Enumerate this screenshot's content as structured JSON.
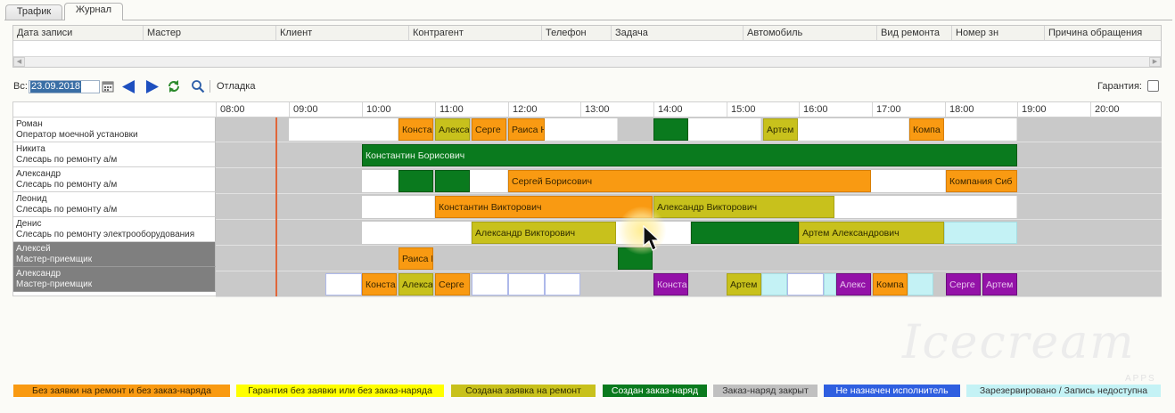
{
  "tabs": [
    {
      "label": "Трафик",
      "active": false
    },
    {
      "label": "Журнал",
      "active": true
    }
  ],
  "journal_columns": [
    "Дата записи",
    "Мастер",
    "Клиент",
    "Контрагент",
    "Телефон",
    "Задача",
    "Автомобиль",
    "Вид ремонта",
    "Номер зн",
    "Причина обращения"
  ],
  "toolbar": {
    "date_label": "Вс:",
    "date_value": "23.09.2018",
    "debug_label": "Отладка",
    "warranty_label": "Гарантия:"
  },
  "hours": [
    "08:00",
    "09:00",
    "10:00",
    "11:00",
    "12:00",
    "13:00",
    "14:00",
    "15:00",
    "16:00",
    "17:00",
    "18:00",
    "19:00",
    "20:00"
  ],
  "staff": [
    {
      "name": "Роман",
      "role": "Оператор моечной установки",
      "dimmed": false
    },
    {
      "name": "Никита",
      "role": "Слесарь по ремонту а/м",
      "dimmed": false
    },
    {
      "name": "Александр",
      "role": "Слесарь по ремонту а/м",
      "dimmed": false
    },
    {
      "name": "Леонид",
      "role": "Слесарь по ремонту а/м",
      "dimmed": false
    },
    {
      "name": "Денис",
      "role": "Слесарь по ремонту электрооборудования",
      "dimmed": false
    },
    {
      "name": "Алексей",
      "role": "Мастер-приемщик",
      "dimmed": true
    },
    {
      "name": "Александр",
      "role": "Мастер-приемщик",
      "dimmed": true
    }
  ],
  "bookings": {
    "r0": [
      "Конста",
      "Алексан",
      "Серге",
      "Раиса Н",
      "Артем",
      "Компа"
    ],
    "r1": [
      "Константин Борисович"
    ],
    "r2": [
      "Сергей Борисович",
      "Компания Сиб"
    ],
    "r3": [
      "Константин Викторович",
      "Александр Викторович"
    ],
    "r4": [
      "Александр Викторович",
      "Артем Александрович"
    ],
    "r5": [
      "Раиса Н"
    ],
    "r6": [
      "Конста",
      "Алексан",
      "Серге",
      "Конста",
      "Артем",
      "Алекс",
      "Компа",
      "Серге",
      "Артем"
    ]
  },
  "legend": [
    {
      "label": "Без заявки на ремонт и без заказ-наряда",
      "color": "#f99a12",
      "text_color": "#3a2600"
    },
    {
      "label": "Гарантия без заявки или без заказ-наряда",
      "color": "#ffff00",
      "text_color": "#333300"
    },
    {
      "label": "Создана заявка на ремонт",
      "color": "#c8c11c",
      "text_color": "#2f2d00"
    },
    {
      "label": "Создан заказ-наряд",
      "color": "#0a7a1e",
      "text_color": "#ffffff"
    },
    {
      "label": "Заказ-наряд закрыт",
      "color": "#c0c0c0",
      "text_color": "#333333"
    },
    {
      "label": "Не назначен исполнитель",
      "color": "#2f5fe0",
      "text_color": "#ffffff"
    },
    {
      "label": "Зарезервировано / Запись недоступна",
      "color": "#c4f2f5",
      "text_color": "#333333"
    }
  ],
  "watermark": {
    "logo": "Icecream",
    "sub": "APPS"
  },
  "icons": [
    "calendar-icon",
    "prev-arrow-icon",
    "next-arrow-icon",
    "refresh-icon",
    "search-icon",
    "mouse-cursor-icon"
  ]
}
